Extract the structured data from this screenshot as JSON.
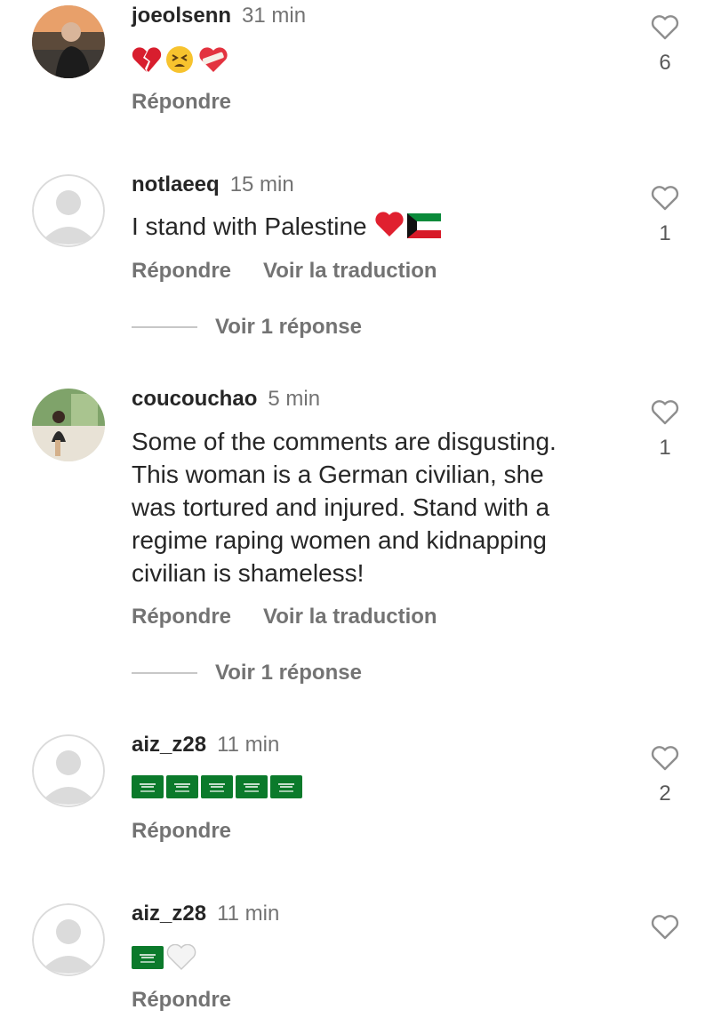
{
  "comments": [
    {
      "username": "joeolsenn",
      "time": "31 min",
      "emoji": [
        "broken-heart-emoji",
        "tired-face-emoji",
        "mending-heart-emoji"
      ],
      "reply_label": "Répondre",
      "likes": "6"
    },
    {
      "username": "notlaeeq",
      "time": "15 min",
      "text": "I stand with Palestine",
      "trailing_emoji": [
        "red-heart-emoji",
        "kuwait-flag-emoji"
      ],
      "reply_label": "Répondre",
      "translate_label": "Voir la traduction",
      "likes": "1",
      "view_replies": "Voir 1 réponse"
    },
    {
      "username": "coucouchao",
      "time": "5 min",
      "text_lines": [
        "Some of the comments are disgusting.",
        "This woman is a German civilian, she",
        "was tortured and injured. Stand with a",
        "regime raping women and kidnapping",
        "civilian is shameless!"
      ],
      "reply_label": "Répondre",
      "translate_label": "Voir la traduction",
      "likes": "1",
      "view_replies": "Voir 1 réponse"
    },
    {
      "username": "aiz_z28",
      "time": "11 min",
      "emoji": [
        "saudi-flag-emoji",
        "saudi-flag-emoji",
        "saudi-flag-emoji",
        "saudi-flag-emoji",
        "saudi-flag-emoji"
      ],
      "reply_label": "Répondre",
      "likes": "2"
    },
    {
      "username": "aiz_z28",
      "time": "11 min",
      "emoji": [
        "saudi-flag-emoji",
        "white-heart-emoji"
      ],
      "reply_label": "Répondre",
      "likes": ""
    }
  ],
  "colors": {
    "username": "#262626",
    "secondary": "#737373",
    "heart_outline": "#8e8e8e",
    "placeholder_avatar": "#dbdbdb",
    "red_heart": "#e0202f",
    "saudi_green": "#0b7a2b"
  }
}
